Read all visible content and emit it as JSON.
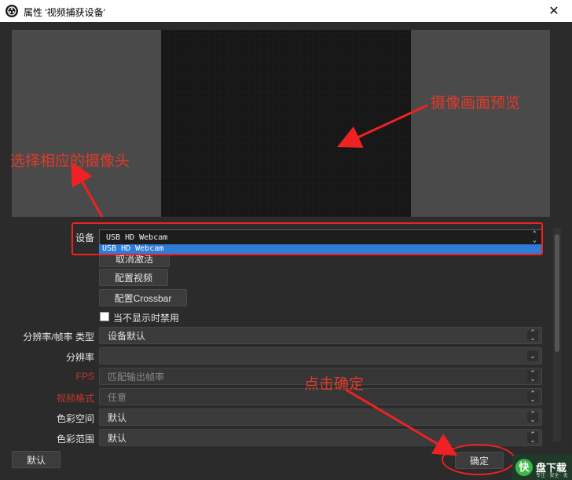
{
  "window": {
    "title": "属性 '视频捕获设备'",
    "close": "✕"
  },
  "properties": {
    "device_label": "设备",
    "device_value": "USB HD Webcam",
    "device_option": "USB HD Webcam",
    "behind_button": "取消激活",
    "configure_video": "配置视频",
    "configure_crossbar": "配置Crossbar",
    "deactivate_checkbox": "当不显示时禁用",
    "resolution_type_label": "分辨率/帧率 类型",
    "resolution_type_value": "设备默认",
    "resolution_label": "分辨率",
    "resolution_value": "",
    "fps_label": "FPS",
    "fps_value": "匹配输出帧率",
    "video_format_label": "视频格式",
    "video_format_value": "任意",
    "color_space_label": "色彩空间",
    "color_space_value": "默认",
    "color_range_label": "色彩范围",
    "color_range_value": "默认"
  },
  "footer": {
    "default_button": "默认",
    "ok_button": "确定"
  },
  "annotations": {
    "preview_note": "摄像画面预览",
    "select_note": "选择相应的摄像头",
    "confirm_note": "点击确定",
    "color": "#e03a2a"
  },
  "watermark": {
    "logo": "快",
    "text": "盘下载",
    "sub": "专注 · 安全 · 无毒"
  }
}
